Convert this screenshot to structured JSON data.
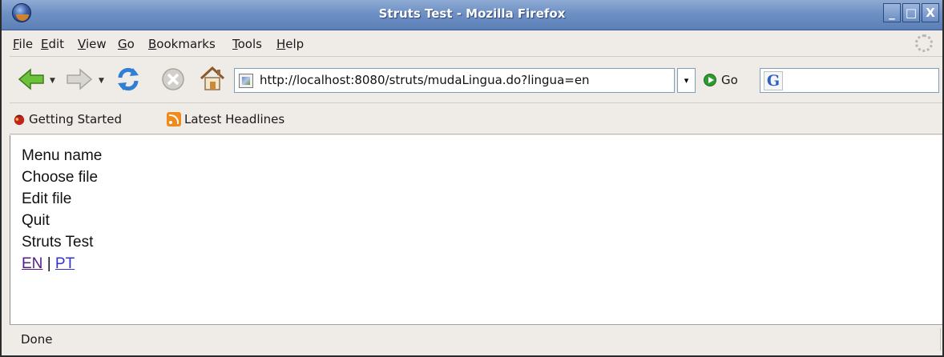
{
  "window": {
    "title": "Struts Test - Mozilla Firefox",
    "controls": [
      "_",
      "□",
      "X"
    ]
  },
  "menubar": {
    "items": [
      {
        "label_u": "F",
        "label_rest": "ile"
      },
      {
        "label_u": "E",
        "label_rest": "dit"
      },
      {
        "label_u": "V",
        "label_rest": "iew"
      },
      {
        "label_u": "G",
        "label_rest": "o"
      },
      {
        "label_u": "B",
        "label_rest": "ookmarks"
      },
      {
        "label_u": "T",
        "label_rest": "ools"
      },
      {
        "label_u": "H",
        "label_rest": "elp"
      }
    ]
  },
  "navbar": {
    "icons": [
      "back-arrow-icon",
      "forward-arrow-icon",
      "reload-icon",
      "stop-icon",
      "home-icon"
    ],
    "url": "http://localhost:8080/struts/mudaLingua.do?lingua=en",
    "dropdown_glyph": "▾",
    "go_label": "Go",
    "search_value": "",
    "search_engine_letter": "G"
  },
  "bookmarks": {
    "items": [
      {
        "label": "Getting Started",
        "icon": "firefox-bookmark-icon"
      },
      {
        "label": "Latest Headlines",
        "icon": "rss-feed-icon"
      }
    ]
  },
  "content": {
    "lines": [
      "Menu name",
      "Choose file",
      "Edit file",
      "Quit",
      "Struts Test"
    ],
    "lang_links": {
      "en": "EN",
      "separator": "|",
      "pt": "PT"
    }
  },
  "status": {
    "text": "Done"
  },
  "colors": {
    "titlebar": "#6e90c4",
    "chrome": "#efebe7",
    "link_visited": "#551a8b",
    "link": "#3333cc",
    "go_green": "#2e9b2e",
    "rss_orange": "#f08a1a"
  }
}
